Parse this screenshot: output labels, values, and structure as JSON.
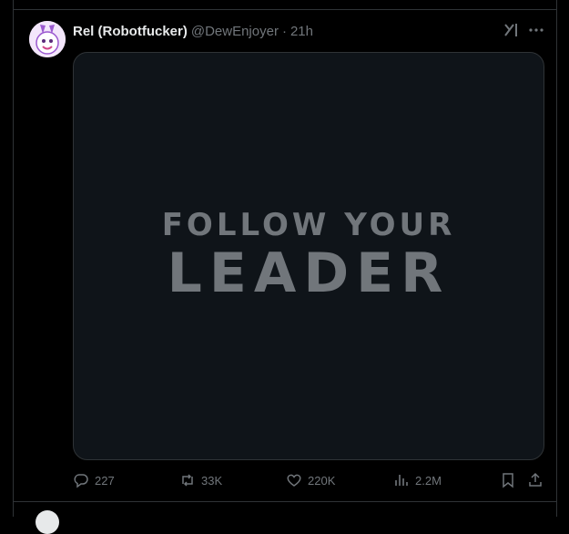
{
  "post": {
    "display_name": "Rel (Robotfucker)",
    "handle": "@DewEnjoyer",
    "separator": "·",
    "time": "21h",
    "media": {
      "line1": "FOLLOW YOUR",
      "line2": "LEADER"
    },
    "actions": {
      "replies": "227",
      "reposts": "33K",
      "likes": "220K",
      "views": "2.2M"
    }
  },
  "icons": {
    "avatar": "avatar",
    "grok": "grok-icon",
    "more": "more-icon",
    "reply": "reply-icon",
    "repost": "repost-icon",
    "like": "heart-icon",
    "views": "views-icon",
    "bookmark": "bookmark-icon",
    "share": "share-icon"
  },
  "colors": {
    "background": "#000000",
    "text": "#e7e9ea",
    "muted": "#71767b",
    "border": "#2f3336"
  }
}
